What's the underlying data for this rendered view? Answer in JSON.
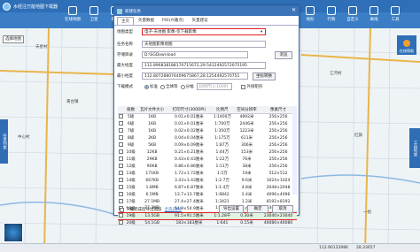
{
  "app": {
    "title": "水经注万能地图下载器"
  },
  "toolbar": {
    "buttons": [
      "在线地图",
      "卫星",
      "影像",
      "标注",
      "地形",
      "行政",
      "自定义",
      "离线",
      "工具",
      "帮助",
      "关于"
    ]
  },
  "map_tabs": [
    "天地图",
    "地图",
    "卫星",
    "地形",
    "其它"
  ],
  "select_map_label": "选择地图",
  "online_label": "在线帮助",
  "side_left": "任务列表",
  "side_right": "工具列表",
  "map_labels": [
    "天星村",
    "黄台镇",
    "中心村",
    "江河村",
    "红旗",
    "一组"
  ],
  "status": {
    "left": "",
    "coord_lon": "112.90133986",
    "coord_lat": "28.33657"
  },
  "dialog": {
    "title": "新建任务",
    "tabs": [
      "主页",
      "矢量数据",
      "POI(兴趣点)",
      "矢量建议"
    ],
    "map_type_label": "地图类型",
    "map_type_value": "电子-天地图  影像-仅下载影像",
    "task_name_label": "任务名称",
    "task_name_value": "天地图影像地图",
    "save_path_label": "存储目录",
    "save_path_value": "D:\\SGDownload",
    "browse_btn": "浏览",
    "max_lon_label": "最大经度",
    "max_lon_value": "112.896838188170715672,29.5412492572075195",
    "min_lon_label": "最小经度",
    "min_lon_value": "112.807288074409675867,28.1254492570751",
    "coord_btn": "坐标转换",
    "exclude_label": "外接矩形",
    "download_mode_label": "下载模式",
    "mode_std": "标准",
    "mode_all": "全球等",
    "mode_tile": "分幅",
    "mode_tile_value": "比例尺(1:1000)",
    "columns": [
      "级数",
      "瓦片文件大小",
      "打印尺寸(300DPI)",
      "比例尺",
      "空间分辨率",
      "像素尺寸"
    ],
    "rows": [
      {
        "level": "5级",
        "size": "1KB",
        "print": "0.01×0.01厘米",
        "scale": "1:1400万",
        "res": "4892米",
        "px": "256×256"
      },
      {
        "level": "6级",
        "size": "1KB",
        "print": "0.01×0.01厘米",
        "scale": "1:700万",
        "res": "2446米",
        "px": "256×256"
      },
      {
        "level": "7级",
        "size": "1KB",
        "print": "0.02×0.02厘米",
        "scale": "1:350万",
        "res": "1223米",
        "px": "256×256"
      },
      {
        "level": "8级",
        "size": "2KB",
        "print": "0.04×0.04厘米",
        "scale": "1:175万",
        "res": "611米",
        "px": "256×256"
      },
      {
        "level": "9级",
        "size": "5KB",
        "print": "0.09×0.09厘米",
        "scale": "1:87万",
        "res": "306米",
        "px": "256×256"
      },
      {
        "level": "10级",
        "size": "12KB",
        "print": "0.21×0.21厘米",
        "scale": "1:44万",
        "res": "153米",
        "px": "256×256"
      },
      {
        "level": "11级",
        "size": "29KB",
        "print": "0.43×0.43厘米",
        "scale": "1:22万",
        "res": "76米",
        "px": "256×256"
      },
      {
        "level": "12级",
        "size": "90KB",
        "print": "0.86×0.86厘米",
        "scale": "1:11万",
        "res": "38米",
        "px": "256×256"
      },
      {
        "level": "13级",
        "size": "171KB",
        "print": "1.72×1.72厘米",
        "scale": "1:5万",
        "res": "19米",
        "px": "512×512"
      },
      {
        "level": "14级",
        "size": "667KB",
        "print": "3.43×3.43厘米",
        "scale": "1:2.7万",
        "res": "9.6米",
        "px": "1024×1024"
      },
      {
        "level": "15级",
        "size": "1.8MB",
        "print": "6.87×6.87厘米",
        "scale": "1:1.4万",
        "res": "4.8米",
        "px": "2048×2048"
      },
      {
        "level": "16级",
        "size": "6.5MB",
        "print": "13.7×13.7厘米",
        "scale": "1:6842",
        "res": "2.4米",
        "px": "4096×4096"
      },
      {
        "level": "17级",
        "size": "27.1MB",
        "print": "27.4×27.4厘米",
        "scale": "1:3421",
        "res": "1.2米",
        "px": "8192×8192"
      },
      {
        "level": "18级",
        "size": "77.3MB",
        "print": "54.9×54.9厘米",
        "scale": "1:1710",
        "res": "0.6米",
        "px": "16384×16384"
      },
      {
        "level": "19级",
        "size": "13.5GB",
        "print": "91.5×91.5厘米",
        "scale": "1:1.28千",
        "res": "0.30米",
        "px": "23040×23040"
      },
      {
        "level": "20级",
        "size": "54.1GB",
        "print": "183×183厘米",
        "scale": "1:641",
        "res": "0.15米",
        "px": "46080×46080"
      }
    ],
    "selected_index": 14,
    "footer_check_label": "下载完成后导出图层",
    "footer_link": "全选|清除",
    "export_btn": "导出设置",
    "ok_btn": "确定",
    "cancel_btn": "取消"
  }
}
